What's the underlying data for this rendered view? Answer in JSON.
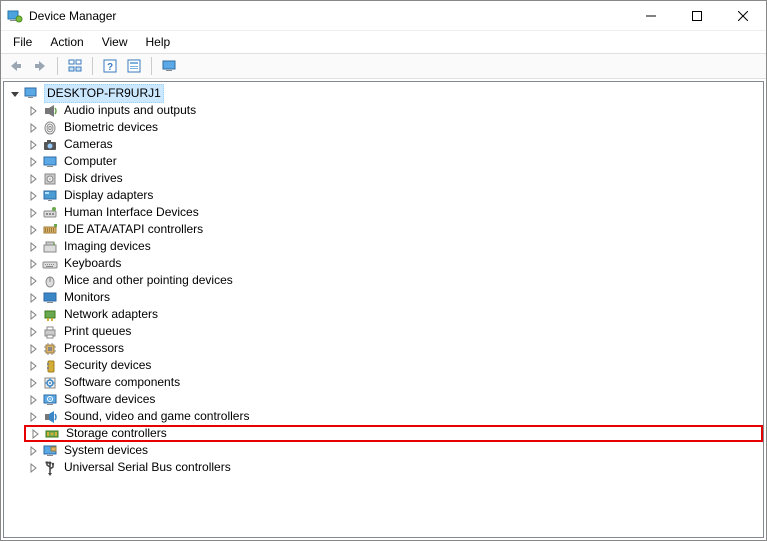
{
  "window": {
    "title": "Device Manager"
  },
  "menu": {
    "file": "File",
    "action": "Action",
    "view": "View",
    "help": "Help"
  },
  "toolbar": {
    "back": "Back",
    "forward": "Forward",
    "show_hidden": "Show hidden devices",
    "help": "Help",
    "properties": "Properties",
    "scan": "Scan for hardware changes"
  },
  "tree": {
    "root": "DESKTOP-FR9URJ1",
    "items": [
      {
        "label": "Audio inputs and outputs",
        "icon": "speaker"
      },
      {
        "label": "Biometric devices",
        "icon": "fingerprint"
      },
      {
        "label": "Cameras",
        "icon": "camera"
      },
      {
        "label": "Computer",
        "icon": "monitor"
      },
      {
        "label": "Disk drives",
        "icon": "disk"
      },
      {
        "label": "Display adapters",
        "icon": "display"
      },
      {
        "label": "Human Interface Devices",
        "icon": "hid"
      },
      {
        "label": "IDE ATA/ATAPI controllers",
        "icon": "ide"
      },
      {
        "label": "Imaging devices",
        "icon": "imaging"
      },
      {
        "label": "Keyboards",
        "icon": "keyboard"
      },
      {
        "label": "Mice and other pointing devices",
        "icon": "mouse"
      },
      {
        "label": "Monitors",
        "icon": "monitor2"
      },
      {
        "label": "Network adapters",
        "icon": "network"
      },
      {
        "label": "Print queues",
        "icon": "printer"
      },
      {
        "label": "Processors",
        "icon": "cpu"
      },
      {
        "label": "Security devices",
        "icon": "security"
      },
      {
        "label": "Software components",
        "icon": "swcomp"
      },
      {
        "label": "Software devices",
        "icon": "swdev"
      },
      {
        "label": "Sound, video and game controllers",
        "icon": "sound"
      },
      {
        "label": "Storage controllers",
        "icon": "storage",
        "highlight": true
      },
      {
        "label": "System devices",
        "icon": "system"
      },
      {
        "label": "Universal Serial Bus controllers",
        "icon": "usb"
      }
    ]
  }
}
